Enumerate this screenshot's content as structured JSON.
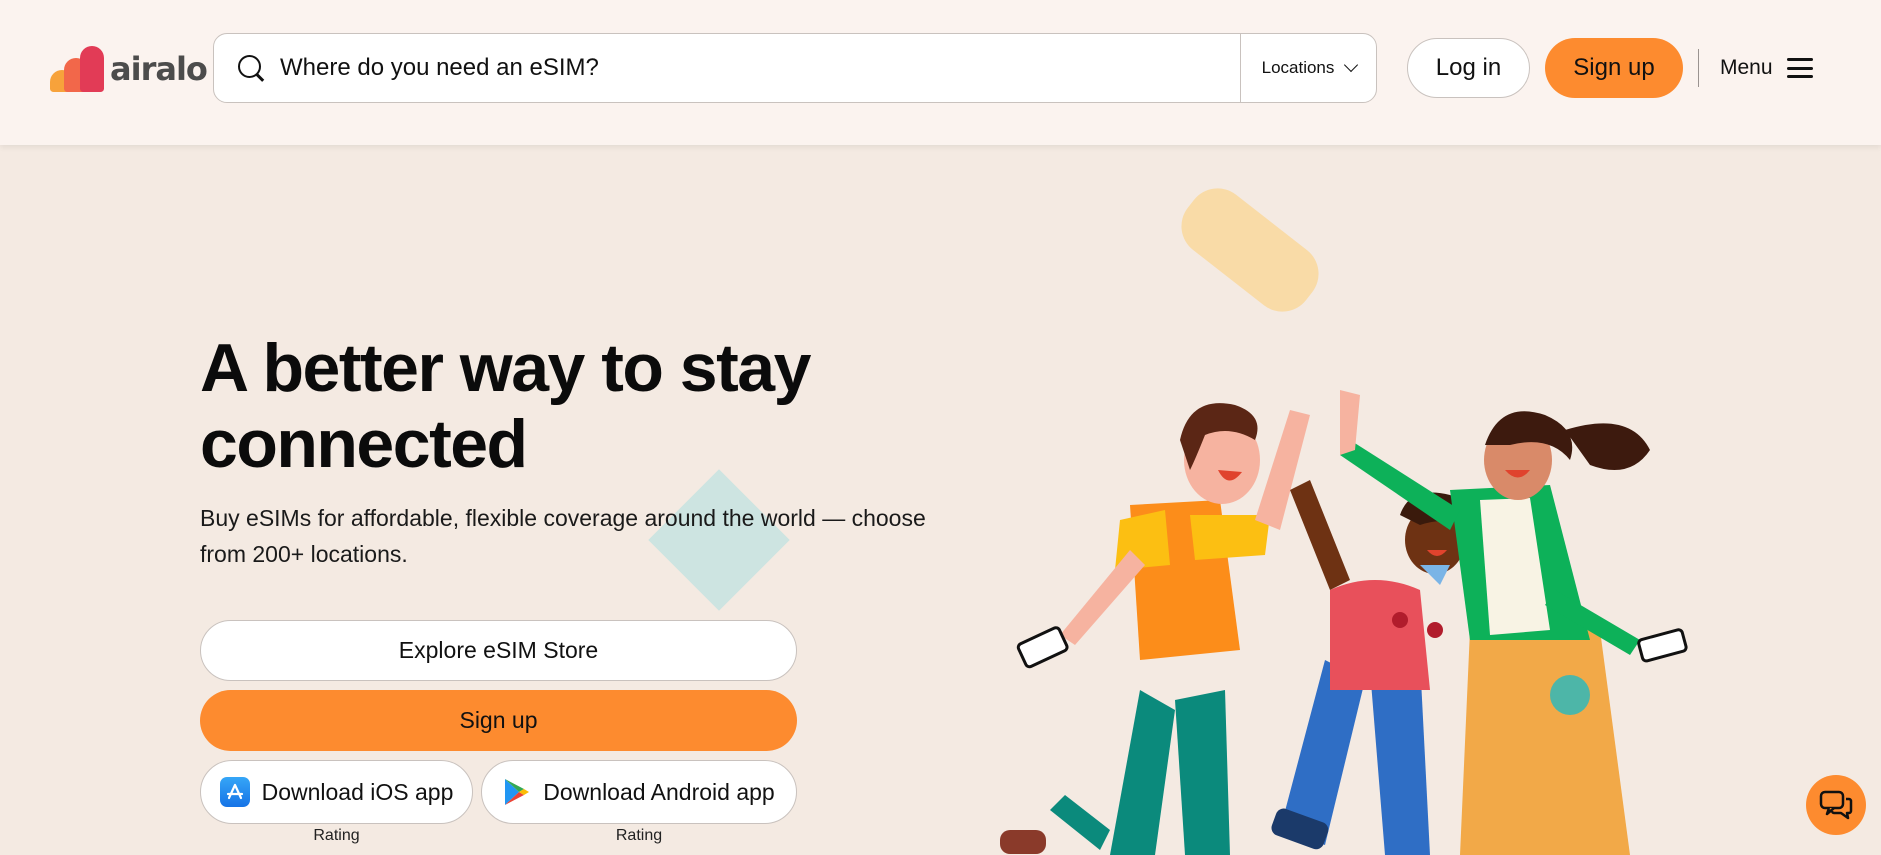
{
  "brand": {
    "name": "airalo"
  },
  "header": {
    "search_placeholder": "Where do you need an eSIM?",
    "locations_label": "Locations",
    "login_label": "Log in",
    "signup_label": "Sign up",
    "menu_label": "Menu"
  },
  "hero": {
    "headline_line1": "A better way to stay",
    "headline_line2": "connected",
    "subtext": "Buy eSIMs for affordable, flexible coverage around the world — choose from 200+ locations.",
    "explore_label": "Explore eSIM Store",
    "signup_label": "Sign up",
    "ios_label": "Download iOS app",
    "android_label": "Download Android app",
    "ios_rating_label": "Rating",
    "android_rating_label": "Rating"
  },
  "colors": {
    "accent": "#fd8b2f",
    "page_background": "#f4eae2",
    "header_background": "#fbf3ef"
  },
  "icons": {
    "search": "search-icon",
    "locations_dropdown": "chevron-down-icon",
    "menu": "hamburger-menu-icon",
    "ios": "app-store-icon",
    "android": "google-play-icon",
    "chat": "chat-icon"
  }
}
